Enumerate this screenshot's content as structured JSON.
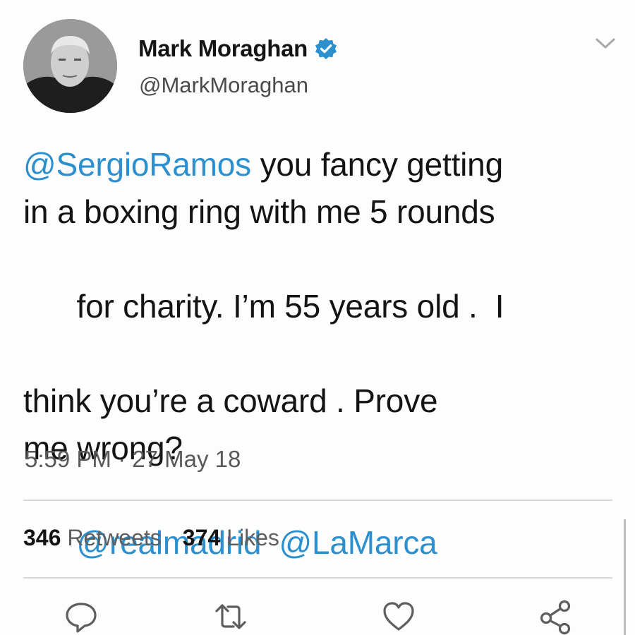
{
  "author": {
    "display_name": "Mark Moraghan",
    "handle": "@MarkMoraghan",
    "verified": true,
    "avatar_icon": "profile-photo"
  },
  "menu": {
    "icon": "chevron-down-icon"
  },
  "tweet": {
    "lines": [
      [
        {
          "text": "@SergioRamos",
          "mention": true
        },
        {
          "text": " you fancy getting",
          "mention": false
        }
      ],
      [
        {
          "text": "in a boxing ring with me 5 rounds",
          "mention": false
        }
      ],
      [
        {
          "text": "for charity. I’m 55 years old .  I",
          "mention": false
        }
      ],
      [
        {
          "text": "think you’re a coward . Prove",
          "mention": false
        }
      ],
      [
        {
          "text": "me wrong?",
          "mention": false
        }
      ],
      [
        {
          "text": "@realmadrid",
          "mention": true
        },
        {
          "text": "  ",
          "mention": false
        },
        {
          "text": "@LaMarca",
          "mention": true
        }
      ]
    ],
    "timestamp": "5:59 PM · 27 May 18"
  },
  "stats": {
    "retweets_count": "346",
    "retweets_label": "Retweets",
    "likes_count": "374",
    "likes_label": "Likes"
  },
  "actions": [
    {
      "name": "reply-icon"
    },
    {
      "name": "retweet-icon"
    },
    {
      "name": "like-icon"
    },
    {
      "name": "share-icon"
    }
  ],
  "colors": {
    "link": "#2c8fce",
    "verified": "#2c8fce",
    "text": "#141414",
    "muted": "#595959",
    "divider": "#d9d9d9"
  }
}
